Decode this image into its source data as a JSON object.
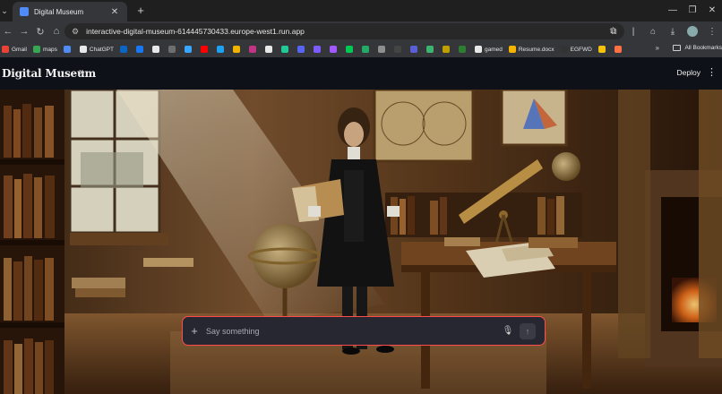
{
  "browser": {
    "tab_title": "Digital Museum",
    "url": "interactive-digital-museum-614445730433.europe-west1.run.app",
    "bookmarks": [
      {
        "label": "Gmail",
        "color": "#ea4335"
      },
      {
        "label": "maps",
        "color": "#34a853"
      },
      {
        "label": "",
        "color": "#4f8cf5"
      },
      {
        "label": "ChatGPT",
        "color": "#e8e8e8"
      },
      {
        "label": "",
        "color": "#0a66c2"
      },
      {
        "label": "",
        "color": "#1877f2"
      },
      {
        "label": "",
        "color": "#e8e8e8"
      },
      {
        "label": "",
        "color": "#6e6e6e"
      },
      {
        "label": "",
        "color": "#3aa6ff"
      },
      {
        "label": "",
        "color": "#ff0000"
      },
      {
        "label": "",
        "color": "#1da1f2"
      },
      {
        "label": "",
        "color": "#f0b400"
      },
      {
        "label": "",
        "color": "#c13584"
      },
      {
        "label": "",
        "color": "#e8e8e8"
      },
      {
        "label": "",
        "color": "#20c997"
      },
      {
        "label": "",
        "color": "#5865f2"
      },
      {
        "label": "",
        "color": "#7b5cff"
      },
      {
        "label": "",
        "color": "#a259ff"
      },
      {
        "label": "",
        "color": "#00c853"
      },
      {
        "label": "",
        "color": "#22aa66"
      },
      {
        "label": "",
        "color": "#8e8e8e"
      },
      {
        "label": "",
        "color": "#444444"
      },
      {
        "label": "",
        "color": "#5a5fd6"
      },
      {
        "label": "",
        "color": "#3cb371"
      },
      {
        "label": "",
        "color": "#c0a000"
      },
      {
        "label": "",
        "color": "#2e7d32"
      },
      {
        "label": "gamed",
        "color": "#e8e8e8"
      },
      {
        "label": "Resume.docx",
        "color": "#f4b400"
      },
      {
        "label": "EGFWD",
        "color": "#333333"
      },
      {
        "label": "",
        "color": "#f4c20d"
      },
      {
        "label": "",
        "color": "#ff7043"
      }
    ],
    "more_label": "»",
    "all_bookmarks_label": "All Bookmarks"
  },
  "app": {
    "logo_text": "Digital Museum",
    "deploy_label": "Deploy",
    "chat_placeholder": "Say something"
  },
  "colors": {
    "accent_border": "#ff4b4b",
    "header_bg": "#0e1117",
    "chat_bg": "#262730"
  }
}
